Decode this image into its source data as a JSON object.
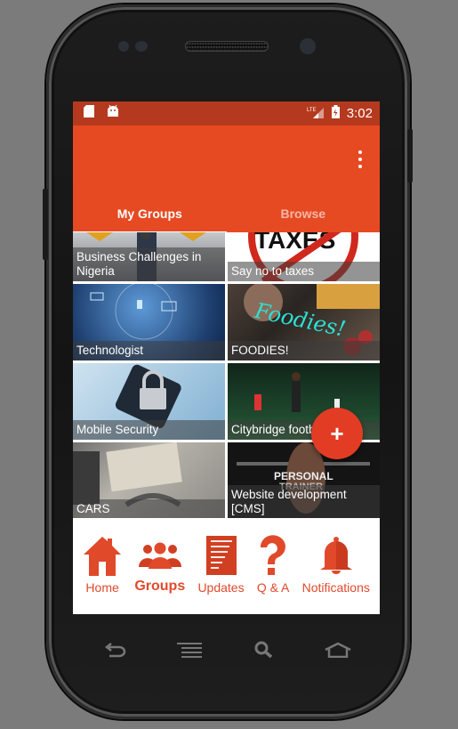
{
  "status_bar": {
    "left_icons": [
      "sd-card-icon",
      "android-icon"
    ],
    "network": "LTE",
    "battery": "charging",
    "time": "3:02"
  },
  "app_bar": {
    "overflow_icon": "more-vert-icon",
    "tabs": [
      {
        "label": "My Groups",
        "active": true
      },
      {
        "label": "Browse",
        "active": false
      }
    ]
  },
  "groups": [
    {
      "name": "Business Challenges in Nigeria"
    },
    {
      "name": "Say no to taxes"
    },
    {
      "name": "Technologist"
    },
    {
      "name": "FOODIES!"
    },
    {
      "name": "Mobile Security"
    },
    {
      "name": "Citybridge football"
    },
    {
      "name": "CARS"
    },
    {
      "name": "Website development [CMS]"
    }
  ],
  "fab": {
    "label": "+",
    "icon": "add-icon"
  },
  "bottom_nav": [
    {
      "label": "Home",
      "icon": "home-icon",
      "active": false
    },
    {
      "label": "Groups",
      "icon": "groups-icon",
      "active": true
    },
    {
      "label": "Updates",
      "icon": "document-icon",
      "active": false
    },
    {
      "label": "Q & A",
      "icon": "question-icon",
      "active": false
    },
    {
      "label": "Notifications",
      "icon": "bell-icon",
      "active": false
    }
  ],
  "hardware_keys": [
    "back",
    "menu",
    "search",
    "home"
  ],
  "colors": {
    "primary": "#e64a23",
    "status_bar": "#b5391e",
    "accent": "#e23c24",
    "nav": "#e1492b"
  }
}
